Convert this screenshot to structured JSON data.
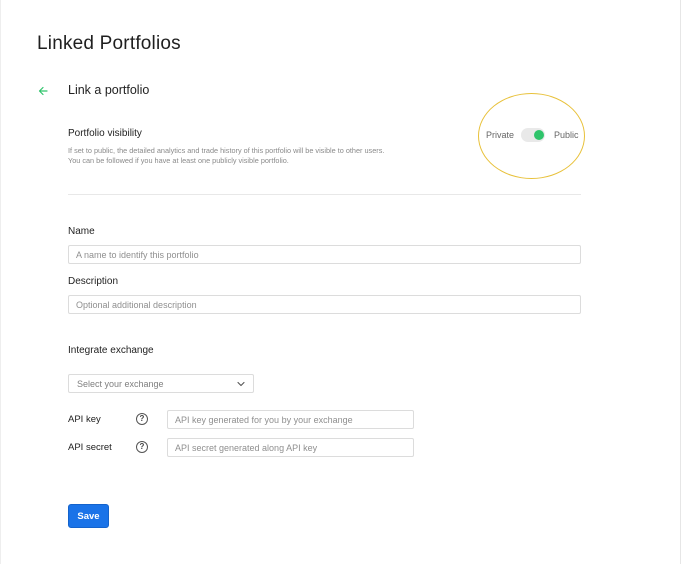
{
  "page": {
    "title": "Linked Portfolios"
  },
  "header": {
    "subheading": "Link a portfolio"
  },
  "visibility": {
    "title": "Portfolio visibility",
    "description_line1": "If set to public, the detailed analytics and trade history of this portfolio will be visible to other users.",
    "description_line2": "You can be followed if you have at least one publicly visible portfolio.",
    "private_label": "Private",
    "public_label": "Public",
    "is_public": true
  },
  "form": {
    "name_label": "Name",
    "name_placeholder": "A name to identify this portfolio",
    "description_label": "Description",
    "description_placeholder": "Optional additional description"
  },
  "exchange": {
    "title": "Integrate exchange",
    "select_placeholder": "Select your exchange",
    "api_key_label": "API key",
    "api_key_placeholder": "API key generated for you by your exchange",
    "api_secret_label": "API secret",
    "api_secret_placeholder": "API secret generated along API key",
    "help_glyph": "?"
  },
  "actions": {
    "save_label": "Save"
  },
  "colors": {
    "accent": "#1a73e8",
    "toggle_on": "#2fc46b",
    "back_arrow": "#2fc46b",
    "highlight": "#e8c13a"
  },
  "icons": {
    "back": "arrow-left-icon",
    "dropdown": "chevron-down-icon",
    "help": "help-icon"
  }
}
